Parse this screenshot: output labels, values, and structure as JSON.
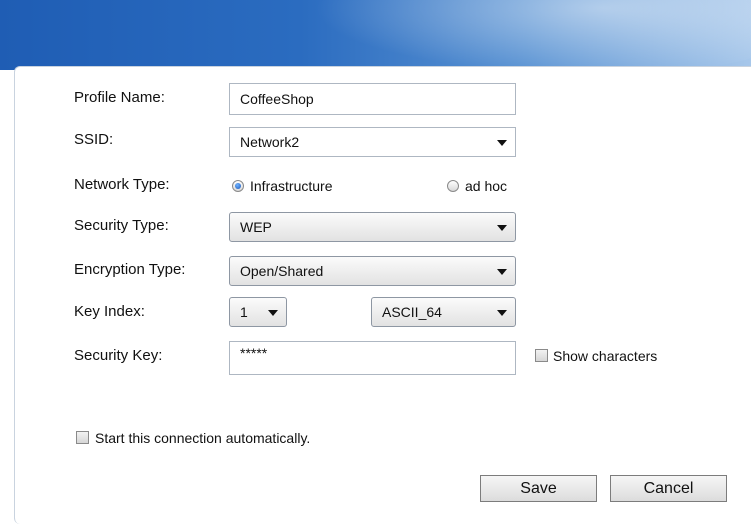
{
  "form": {
    "profile_name_label": "Profile Name:",
    "profile_name_value": "CoffeeShop",
    "ssid_label": "SSID:",
    "ssid_value": "Network2",
    "network_type_label": "Network Type:",
    "network_type_options": [
      "Infrastructure",
      "ad hoc"
    ],
    "network_type_selected": "Infrastructure",
    "security_type_label": "Security Type:",
    "security_type_value": "WEP",
    "encryption_type_label": "Encryption Type:",
    "encryption_type_value": "Open/Shared",
    "key_index_label": "Key Index:",
    "key_index_value": "1",
    "key_format_value": "ASCII_64",
    "security_key_label": "Security Key:",
    "security_key_value": "*****",
    "show_characters_label": "Show characters",
    "show_characters_checked": false,
    "auto_start_label": "Start this connection automatically.",
    "auto_start_checked": false
  },
  "buttons": {
    "save_label": "Save",
    "cancel_label": "Cancel"
  },
  "colors": {
    "header_blue": "#1f5db4",
    "radio_selected": "#1b56b8"
  }
}
